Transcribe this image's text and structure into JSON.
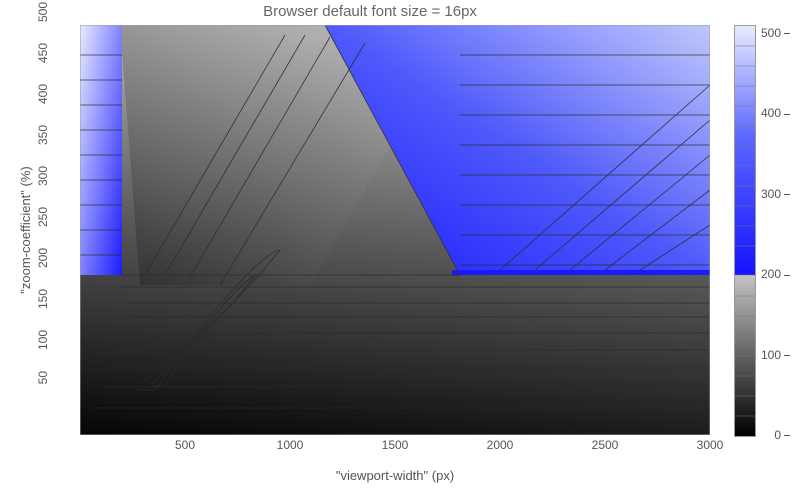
{
  "chart_data": {
    "type": "heatmap",
    "title": "Browser default font size = 16px",
    "xlabel": "\"viewport-width\" (px)",
    "ylabel": "\"zoom-coefficient\" (%)",
    "x_ticks": [
      500,
      1000,
      1500,
      2000,
      2500,
      3000
    ],
    "y_ticks": [
      50,
      100,
      150,
      200,
      250,
      300,
      350,
      400,
      450,
      500
    ],
    "xlim": [
      0,
      3000
    ],
    "ylim": [
      0,
      500
    ],
    "colorbar": {
      "min": 0,
      "max": 510,
      "ticks": [
        0,
        100,
        200,
        300,
        400,
        500
      ],
      "scale_note": "gray 0–200, blue 200–510"
    },
    "contour_levels": [
      0,
      20,
      40,
      60,
      80,
      100,
      120,
      140,
      160,
      180,
      200,
      225,
      250,
      275,
      300,
      325,
      350,
      375,
      400,
      425,
      450,
      475,
      500
    ],
    "data_note": "Contour/heatmap of a computed font-size-like value over viewport-width × zoom-coefficient. Values below ~200 render in gray gradient; above ~200 in blue gradient. High-value blue region occupies the upper-right triangular area and a narrow upper-left strip; darkest values along the bottom edge and a curved low-value trough running from lower-left toward upper-center."
  }
}
